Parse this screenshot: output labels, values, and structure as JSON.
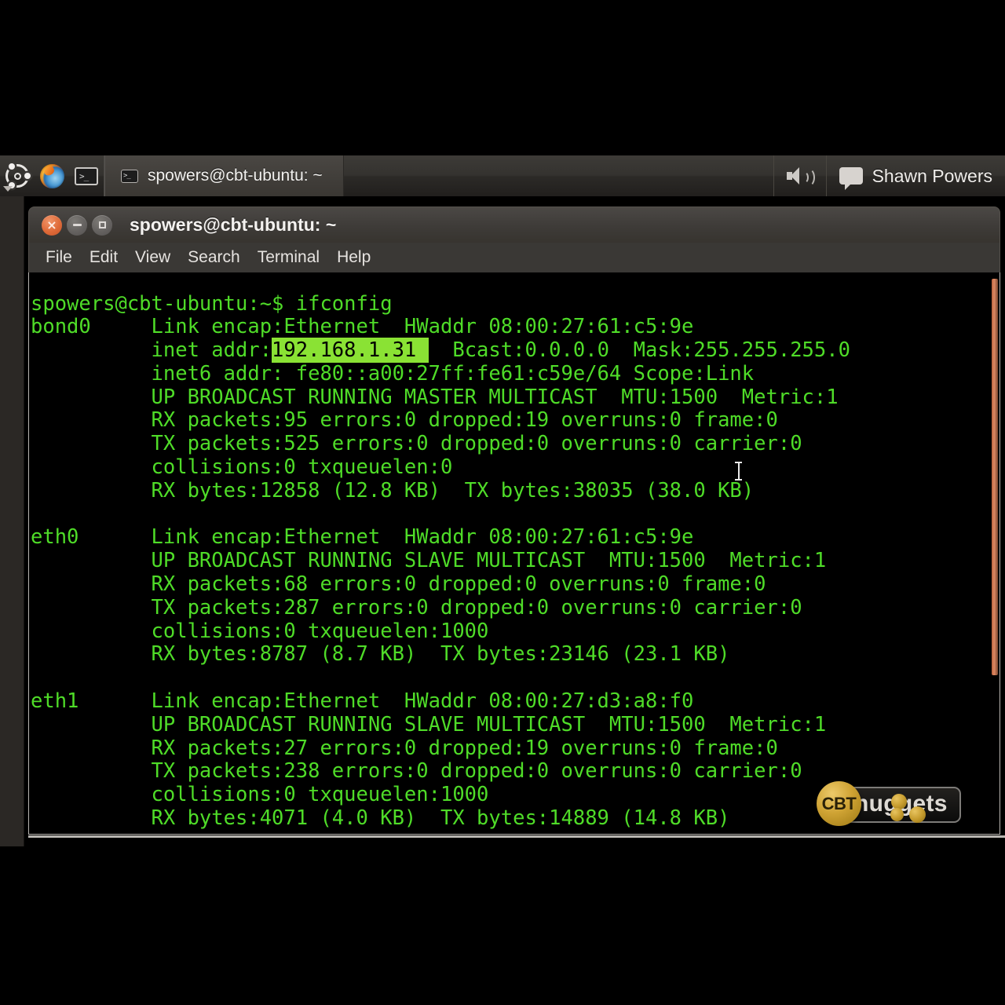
{
  "desktop": {
    "launcher": {
      "items": [
        {
          "name": "ubuntu-dash-icon",
          "label": "Dash home"
        },
        {
          "name": "firefox-icon",
          "label": "Firefox Web Browser"
        },
        {
          "name": "terminal-icon",
          "label": "Terminal"
        }
      ]
    },
    "top_panel": {
      "taskbar_item_label": "spowers@cbt-ubuntu: ~",
      "taskbar_item_icon": "terminal-icon",
      "volume_icon": "speaker-icon",
      "messaging_icon": "chat-bubble-icon",
      "username": "Shawn Powers"
    }
  },
  "window": {
    "title": "spowers@cbt-ubuntu: ~",
    "controls": {
      "close": "close-button",
      "minimize": "minimize-button",
      "maximize": "maximize-button"
    },
    "menu": [
      "File",
      "Edit",
      "View",
      "Search",
      "Terminal",
      "Help"
    ]
  },
  "terminal": {
    "prompt_line": "spowers@cbt-ubuntu:~$ ifconfig",
    "selection": "192.168.1.31",
    "selection_bg": "#8ae234",
    "foreground": "#4fdc28",
    "background": "#000000",
    "lines_before_selection": [
      "spowers@cbt-ubuntu:~$ ifconfig",
      "bond0     Link encap:Ethernet  HWaddr 08:00:27:61:c5:9e"
    ],
    "selection_line_prefix": "          inet addr:",
    "selection_line_suffix": "  Bcast:0.0.0.0  Mask:255.255.255.0",
    "lines_after_selection": [
      "          inet6 addr: fe80::a00:27ff:fe61:c59e/64 Scope:Link",
      "          UP BROADCAST RUNNING MASTER MULTICAST  MTU:1500  Metric:1",
      "          RX packets:95 errors:0 dropped:19 overruns:0 frame:0",
      "          TX packets:525 errors:0 dropped:0 overruns:0 carrier:0",
      "          collisions:0 txqueuelen:0",
      "          RX bytes:12858 (12.8 KB)  TX bytes:38035 (38.0 KB)",
      "",
      "eth0      Link encap:Ethernet  HWaddr 08:00:27:61:c5:9e",
      "          UP BROADCAST RUNNING SLAVE MULTICAST  MTU:1500  Metric:1",
      "          RX packets:68 errors:0 dropped:0 overruns:0 frame:0",
      "          TX packets:287 errors:0 dropped:0 overruns:0 carrier:0",
      "          collisions:0 txqueuelen:1000",
      "          RX bytes:8787 (8.7 KB)  TX bytes:23146 (23.1 KB)",
      "",
      "eth1      Link encap:Ethernet  HWaddr 08:00:27:d3:a8:f0",
      "          UP BROADCAST RUNNING SLAVE MULTICAST  MTU:1500  Metric:1",
      "          RX packets:27 errors:0 dropped:19 overruns:0 frame:0",
      "          TX packets:238 errors:0 dropped:0 overruns:0 carrier:0",
      "          collisions:0 txqueuelen:1000",
      "          RX bytes:4071 (4.0 KB)  TX bytes:14889 (14.8 KB)"
    ],
    "interfaces": [
      {
        "name": "bond0",
        "link_encap": "Ethernet",
        "hwaddr": "08:00:27:61:c5:9e",
        "inet_addr": "192.168.1.31",
        "bcast": "0.0.0.0",
        "mask": "255.255.255.0",
        "inet6_addr": "fe80::a00:27ff:fe61:c59e/64",
        "scope": "Link",
        "flags": "UP BROADCAST RUNNING MASTER MULTICAST",
        "mtu": "1500",
        "metric": "1",
        "rx_packets": "95",
        "rx_errors": "0",
        "rx_dropped": "19",
        "rx_overruns": "0",
        "frame": "0",
        "tx_packets": "525",
        "tx_errors": "0",
        "tx_dropped": "0",
        "tx_overruns": "0",
        "carrier": "0",
        "collisions": "0",
        "txqueuelen": "0",
        "rx_bytes": "12858 (12.8 KB)",
        "tx_bytes": "38035 (38.0 KB)"
      },
      {
        "name": "eth0",
        "link_encap": "Ethernet",
        "hwaddr": "08:00:27:61:c5:9e",
        "flags": "UP BROADCAST RUNNING SLAVE MULTICAST",
        "mtu": "1500",
        "metric": "1",
        "rx_packets": "68",
        "rx_errors": "0",
        "rx_dropped": "0",
        "rx_overruns": "0",
        "frame": "0",
        "tx_packets": "287",
        "tx_errors": "0",
        "tx_dropped": "0",
        "tx_overruns": "0",
        "carrier": "0",
        "collisions": "0",
        "txqueuelen": "1000",
        "rx_bytes": "8787 (8.7 KB)",
        "tx_bytes": "23146 (23.1 KB)"
      },
      {
        "name": "eth1",
        "link_encap": "Ethernet",
        "hwaddr": "08:00:27:d3:a8:f0",
        "flags": "UP BROADCAST RUNNING SLAVE MULTICAST",
        "mtu": "1500",
        "metric": "1",
        "rx_packets": "27",
        "rx_errors": "0",
        "rx_dropped": "19",
        "rx_overruns": "0",
        "frame": "0",
        "tx_packets": "238",
        "tx_errors": "0",
        "tx_dropped": "0",
        "tx_overruns": "0",
        "carrier": "0",
        "collisions": "0",
        "txqueuelen": "1000",
        "rx_bytes": "4071 (4.0 KB)",
        "tx_bytes": "14889 (14.8 KB)"
      }
    ]
  },
  "watermark": {
    "badge": "CBT",
    "text": "nuggets"
  }
}
